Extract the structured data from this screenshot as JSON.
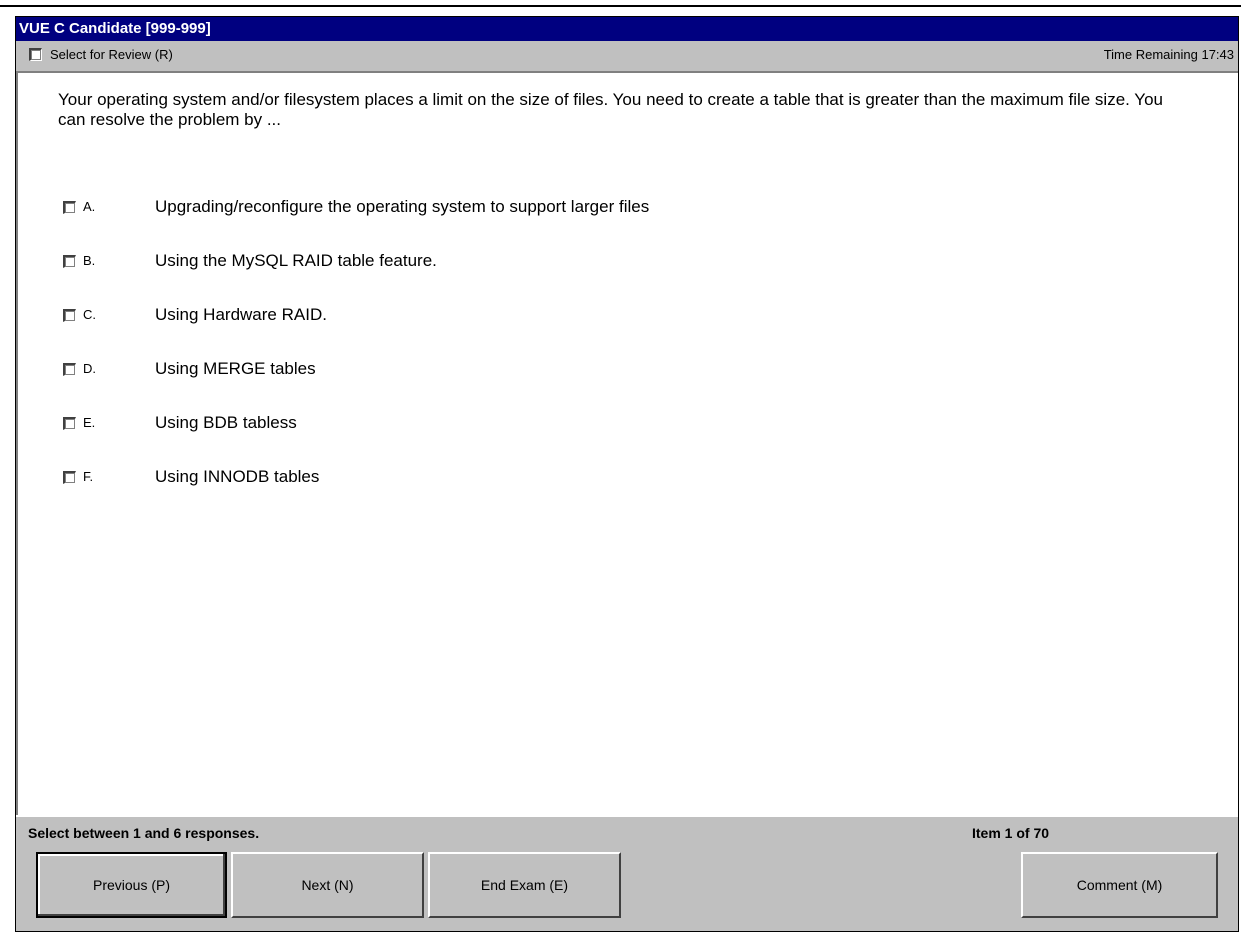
{
  "window": {
    "title": "VUE C Candidate [999-999]"
  },
  "review": {
    "label": "Select for Review (R)",
    "checked": false
  },
  "timer": {
    "text": "Time Remaining 17:43"
  },
  "question": {
    "text": "Your operating system and/or filesystem places a limit on the size of files. You need to create a table that is greater than the maximum file size. You can resolve the problem by ...",
    "options": [
      {
        "letter": "A.",
        "text": "Upgrading/reconfigure the operating system to support larger files"
      },
      {
        "letter": "B.",
        "text": "Using the MySQL RAID table feature."
      },
      {
        "letter": "C.",
        "text": "Using Hardware RAID."
      },
      {
        "letter": "D.",
        "text": "Using MERGE tables"
      },
      {
        "letter": "E.",
        "text": "Using BDB tabless"
      },
      {
        "letter": "F.",
        "text": "Using INNODB tables"
      }
    ]
  },
  "footer": {
    "instructions": "Select between 1 and 6 responses.",
    "item_count": "Item 1 of 70",
    "previous_label": "Previous (P)",
    "next_label": "Next (N)",
    "end_label": "End Exam (E)",
    "comment_label": "Comment (M)"
  }
}
